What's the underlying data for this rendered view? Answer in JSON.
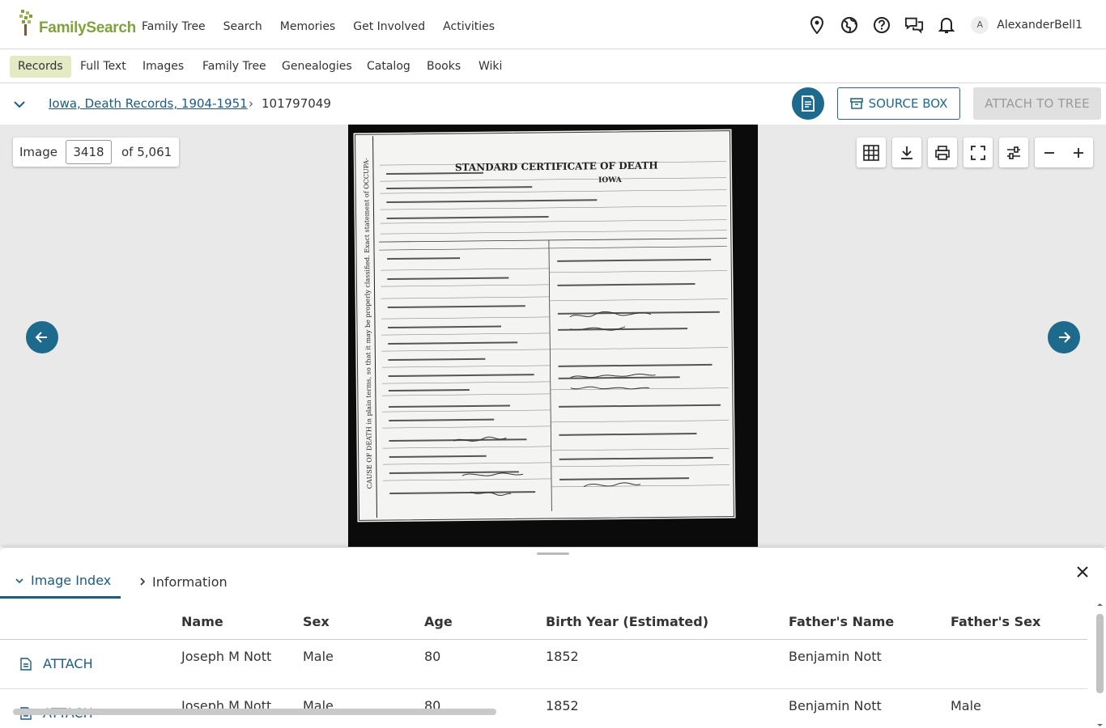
{
  "header": {
    "logo_text": "FamilySearch",
    "nav": [
      "Family Tree",
      "Search",
      "Memories",
      "Get Involved",
      "Activities"
    ],
    "avatar_initial": "A",
    "username": "AlexanderBell1"
  },
  "subnav": {
    "items": [
      "Records",
      "Full Text",
      "Images",
      "Family Tree",
      "Genealogies",
      "Catalog",
      "Books",
      "Wiki"
    ],
    "active": "Records"
  },
  "breadcrumb": {
    "collection": "Iowa, Death Records, 1904-1951",
    "separator": "›",
    "record_id": "101797049"
  },
  "actions": {
    "source_box": "SOURCE BOX",
    "attach_to_tree": "ATTACH TO TREE"
  },
  "viewer": {
    "image_label": "Image",
    "image_number": "3418",
    "image_total": "of 5,061",
    "certificate_title": "STANDARD CERTIFICATE OF DEATH",
    "certificate_state": "IOWA"
  },
  "panel": {
    "tabs": [
      "Image Index",
      "Information"
    ],
    "active_tab": "Image Index",
    "columns": [
      "Name",
      "Sex",
      "Age",
      "Birth Year (Estimated)",
      "Father's Name",
      "Father's Sex"
    ],
    "rows": [
      {
        "action": "ATTACH",
        "name": "Joseph M Nott",
        "sex": "Male",
        "age": "80",
        "birth_year": "1852",
        "father_name": "Benjamin Nott",
        "father_sex": ""
      },
      {
        "action": "ATTACH",
        "name": "Joseph M Nott",
        "sex": "Male",
        "age": "80",
        "birth_year": "1852",
        "father_name": "Benjamin Nott",
        "father_sex": "Male"
      }
    ]
  },
  "colors": {
    "brand_green": "#7fa33a",
    "primary_blue": "#1e6a8d",
    "link_blue": "#1a5c86",
    "active_tab_bg": "#e4eac4"
  }
}
